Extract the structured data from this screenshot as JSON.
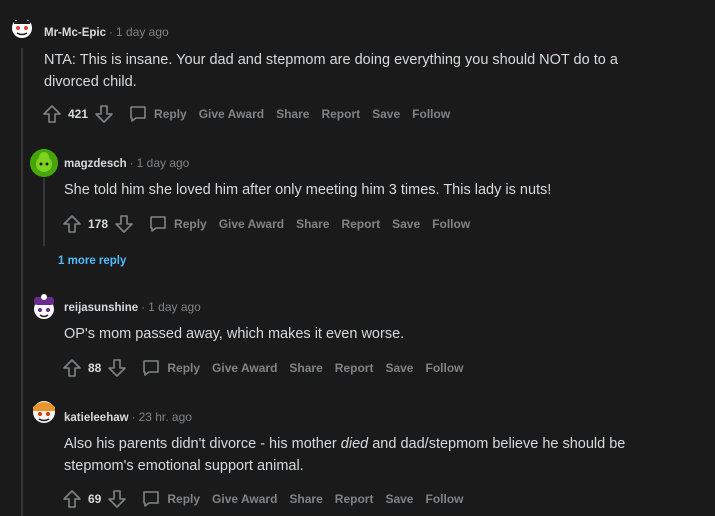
{
  "comments": [
    {
      "username": "Mr-Mc-Epic",
      "time": "1 day ago",
      "text": "NTA: This is insane. Your dad and stepmom are doing everything you should NOT do to a divorced child.",
      "votes": "421"
    },
    {
      "username": "magzdesch",
      "time": "1 day ago",
      "text": "She told him she loved him after only meeting him 3 times. This lady is nuts!",
      "votes": "178"
    },
    {
      "username": "reijasunshine",
      "time": "1 day ago",
      "text": "OP's mom passed away, which makes it even worse.",
      "votes": "88"
    },
    {
      "username": "katieleehaw",
      "time": "23 hr. ago",
      "text_before": "Also his parents didn't divorce - his mother ",
      "text_em": "died",
      "text_after": " and dad/stepmom believe he should be stepmom's emotional support animal.",
      "votes": "69"
    }
  ],
  "actions": {
    "reply": "Reply",
    "give_award": "Give Award",
    "share": "Share",
    "report": "Report",
    "save": "Save",
    "follow": "Follow"
  },
  "more_replies": "1 more reply",
  "separator": "·",
  "colors": {
    "background": "#1a1a1b",
    "text": "#d7dadc",
    "muted": "#818384",
    "link": "#4fbcff",
    "thread_line": "#343536"
  }
}
